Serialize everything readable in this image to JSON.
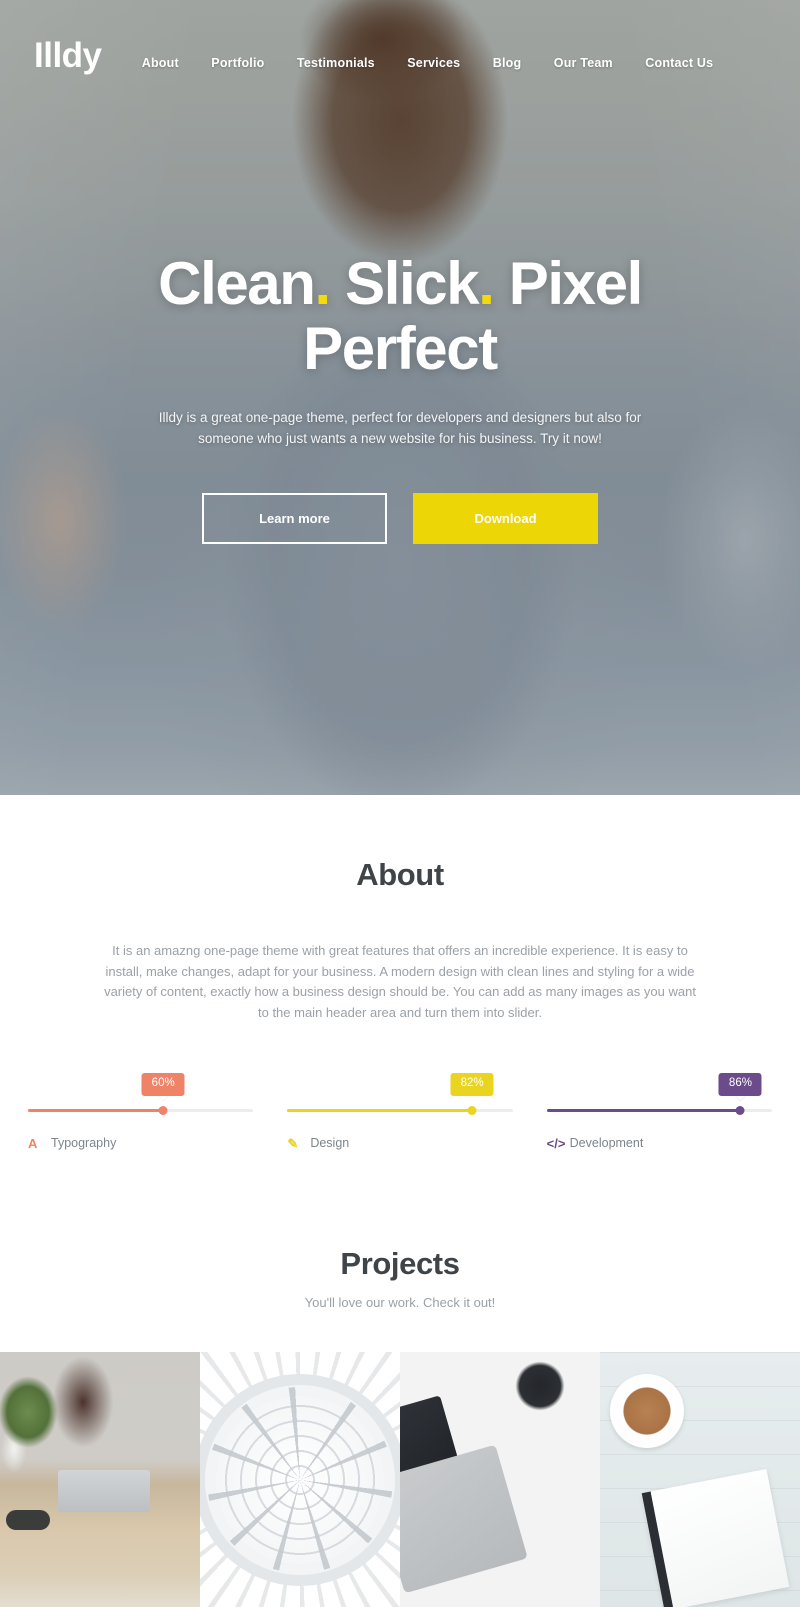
{
  "site": {
    "logo": "Illdy"
  },
  "nav": {
    "items": [
      {
        "label": "About"
      },
      {
        "label": "Portfolio"
      },
      {
        "label": "Testimonials"
      },
      {
        "label": "Services"
      },
      {
        "label": "Blog"
      },
      {
        "label": "Our Team"
      },
      {
        "label": "Contact Us"
      }
    ]
  },
  "hero": {
    "heading_part1": "Clean",
    "heading_dot1": ".",
    "heading_part2": " Slick",
    "heading_dot2": ".",
    "heading_part3": " Pixel Perfect",
    "subtitle": "Illdy is a great one-page theme, perfect for developers and designers but also for someone who just wants a new website for his business. Try it now!",
    "btn_learn_more": "Learn more",
    "btn_download": "Download",
    "accent_yellow": "#edd606"
  },
  "about": {
    "title": "About",
    "body": "It is an amazng one-page theme with great features that offers an incredible experience. It is easy to install, make changes, adapt for your business. A modern design with clean lines and styling for a wide variety of content, exactly how a business design should be. You can add as many images as you want to the main header area and turn them into slider."
  },
  "skills": [
    {
      "name": "Typography",
      "percent": 60,
      "percent_label": "60%",
      "icon": "letter-a-icon",
      "icon_glyph": "A",
      "color": "#ef8368"
    },
    {
      "name": "Design",
      "percent": 82,
      "percent_label": "82%",
      "icon": "pencil-icon",
      "icon_glyph": "✎",
      "color": "#e9d41f"
    },
    {
      "name": "Development",
      "percent": 86,
      "percent_label": "86%",
      "icon": "code-icon",
      "icon_glyph": "</>",
      "color": "#6b4b8a"
    }
  ],
  "projects": {
    "title": "Projects",
    "subtitle": "You'll love our work. Check it out!",
    "tiles": [
      {
        "alt": "desk with plant, laptop, glasses and notebook"
      },
      {
        "alt": "white architectural glass dome ceiling"
      },
      {
        "alt": "laptop with headphones and turntable"
      },
      {
        "alt": "coffee cup, notebook and pen on white wood"
      }
    ]
  }
}
